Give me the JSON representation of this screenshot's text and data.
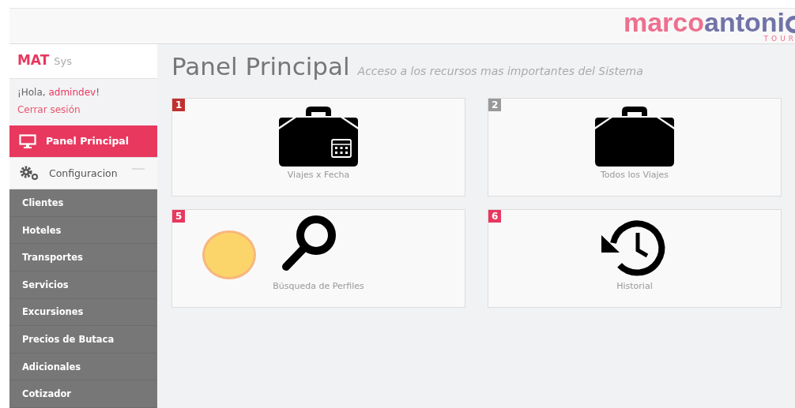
{
  "logo": {
    "name_first": "marco",
    "name_second": "antoni",
    "tagline": "TOUR"
  },
  "sidebar": {
    "brand": "MAT",
    "brand_suffix": "Sys",
    "greeting": "¡Hola, ",
    "user": "admindev",
    "greeting_end": "!",
    "logout": "Cerrar sesión",
    "nav": [
      {
        "label": "Panel Principal",
        "kind": "dashboard",
        "selected": true
      },
      {
        "label": "Configuracion",
        "kind": "settings",
        "selected": false
      }
    ],
    "submenu": [
      {
        "label": "Clientes"
      },
      {
        "label": "Hoteles"
      },
      {
        "label": "Transportes"
      },
      {
        "label": "Servicios"
      },
      {
        "label": "Excursiones"
      },
      {
        "label": "Precios de Butaca"
      },
      {
        "label": "Adicionales"
      },
      {
        "label": "Cotizador"
      }
    ]
  },
  "page": {
    "title": "Panel Principal",
    "subtitle": "Acceso a los recursos mas importantes del Sistema"
  },
  "cards": [
    {
      "number": "1",
      "label": "Viajes x Fecha",
      "kind": "calendar",
      "color": "#c0302f"
    },
    {
      "number": "2",
      "label": "Todos los Viajes",
      "kind": "case",
      "color": "#999999"
    },
    {
      "number": "5",
      "label": "Búsqueda de Perfiles",
      "kind": "search",
      "color": "#e8385e"
    },
    {
      "number": "6",
      "label": "Historial",
      "kind": "history",
      "color": "#e8385e"
    }
  ]
}
